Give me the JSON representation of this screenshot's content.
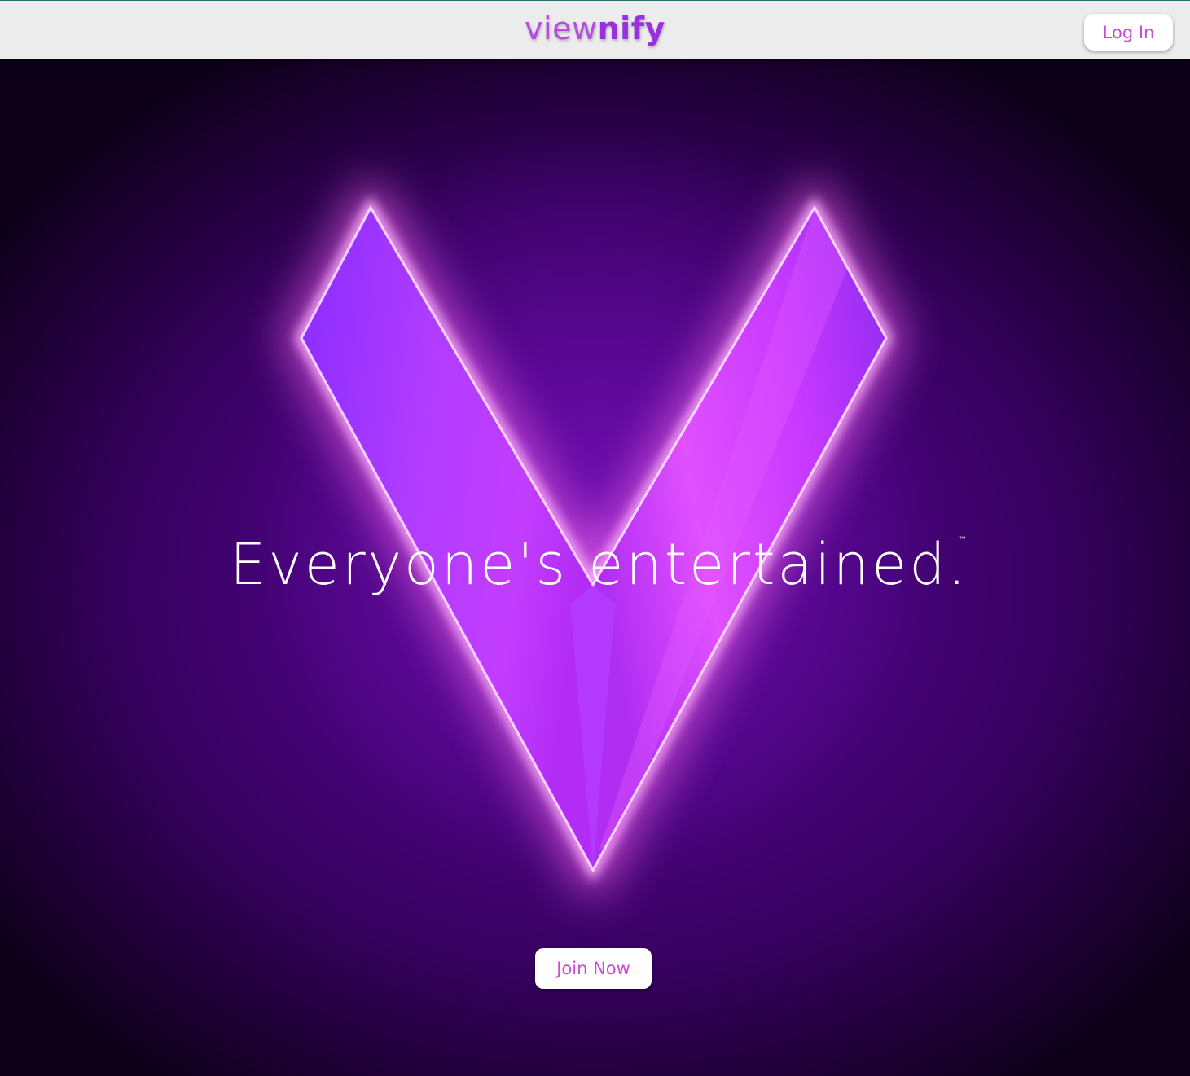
{
  "header": {
    "logo_light": "view",
    "logo_bold": "nify",
    "login_label": "Log In"
  },
  "hero": {
    "tagline": "Everyone's entertained.",
    "trademark": "™",
    "join_label": "Join Now",
    "logo_mark": "v-logo-icon"
  },
  "colors": {
    "brand_purple": "#9a2fe0",
    "button_text": "#c94bd3",
    "header_bg": "#ececec",
    "hero_bg": "#4a047e",
    "glow": "#ff7af5"
  }
}
